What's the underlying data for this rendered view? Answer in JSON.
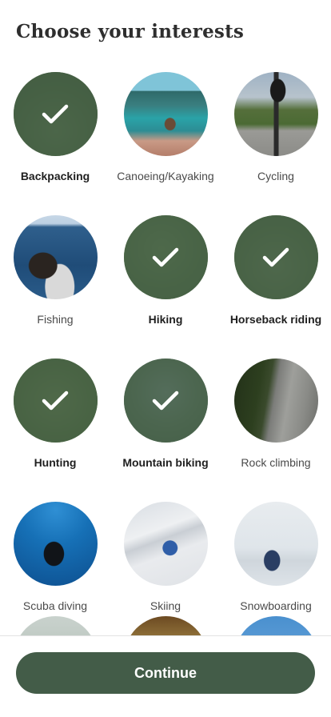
{
  "page": {
    "title": "Choose your interests"
  },
  "interests": [
    {
      "label": "Backpacking",
      "selected": true,
      "image": "backpacking-photo"
    },
    {
      "label": "Canoeing/Kayaking",
      "selected": false,
      "image": "canoeing-photo"
    },
    {
      "label": "Cycling",
      "selected": false,
      "image": "cycling-photo"
    },
    {
      "label": "Fishing",
      "selected": false,
      "image": "fishing-photo"
    },
    {
      "label": "Hiking",
      "selected": true,
      "image": "hiking-photo"
    },
    {
      "label": "Horseback riding",
      "selected": true,
      "image": "horseback-photo"
    },
    {
      "label": "Hunting",
      "selected": true,
      "image": "hunting-photo"
    },
    {
      "label": "Mountain biking",
      "selected": true,
      "image": "mtb-photo"
    },
    {
      "label": "Rock climbing",
      "selected": false,
      "image": "rock-photo"
    },
    {
      "label": "Scuba diving",
      "selected": false,
      "image": "scuba-photo"
    },
    {
      "label": "Skiing",
      "selected": false,
      "image": "skiing-photo"
    },
    {
      "label": "Snowboarding",
      "selected": false,
      "image": "snowboarding-photo"
    }
  ],
  "footer": {
    "continue_label": "Continue"
  },
  "colors": {
    "accent": "#435c48",
    "selected_overlay": "#445e46",
    "text": "#2e2e2e"
  }
}
